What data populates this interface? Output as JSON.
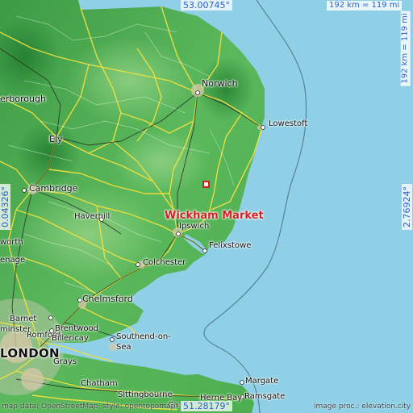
{
  "coordinates": {
    "top": "53.00745°",
    "bottom": "51.28179°",
    "left": "0.04326°",
    "right": "2.76924°"
  },
  "scale": {
    "horizontal": "192 km = 119 mi",
    "vertical": "192 km = 119 mi"
  },
  "selected_place": "Wickham Market",
  "places": {
    "norwich": "Norwich",
    "lowestoft": "Lowestoft",
    "ely": "Ely",
    "cambridge": "Cambridge",
    "haverhill": "Haverhill",
    "ipswich": "Ipswich",
    "felixstowe": "Felixstowe",
    "colchester": "Colchester",
    "chelmsford": "Chelmsford",
    "brentwood": "Brentwood",
    "romford": "Romford",
    "billericay": "Billericay",
    "southend": "Southend-on-",
    "southend2": "Sea",
    "london": "LONDON",
    "barnet": "Barnet",
    "grays": "Grays",
    "chatham": "Chatham",
    "sittingbourne": "Sittingbourne",
    "margate": "Margate",
    "ramsgate": "Ramsgate",
    "hernebay": "Herne Bay",
    "peterborough": "erborough",
    "worth": "worth",
    "enage": "enage",
    "minster": "minster",
    "ca": "Ca"
  },
  "credits": {
    "left": "map data: OpenStreetMap, style: opentopomap",
    "right": "image proc.: elevation.city"
  },
  "colors": {
    "sea": "#8fd0e6",
    "land": "#4caf50",
    "road": "#f0e040",
    "marker": "#d42020",
    "coord_text": "#2a5fd0"
  }
}
